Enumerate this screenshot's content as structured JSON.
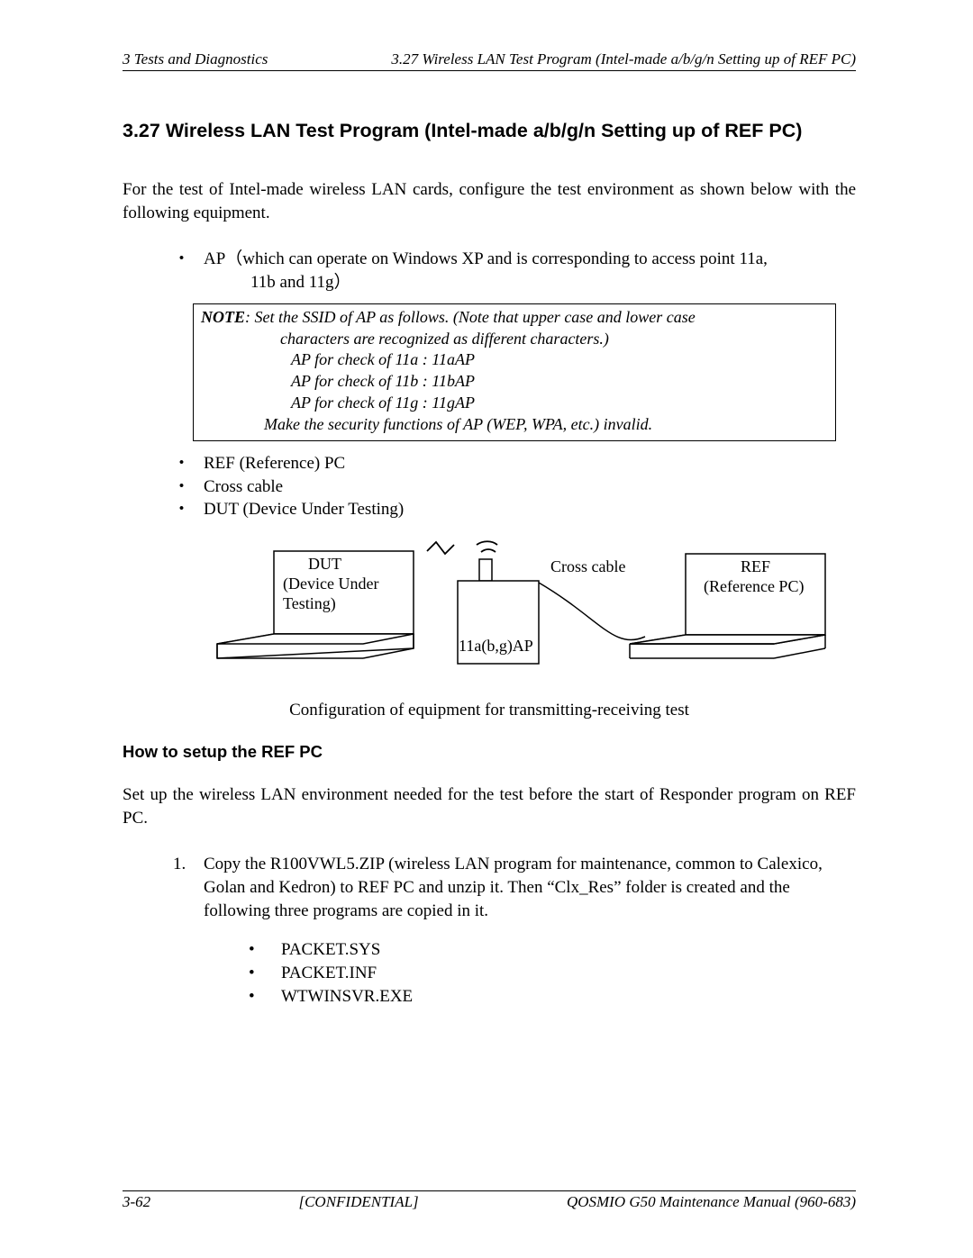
{
  "header": {
    "left": "3 Tests and Diagnostics",
    "right": "3.27 Wireless LAN Test Program (Intel-made a/b/g/n Setting up of REF PC)"
  },
  "section_heading": "3.27  Wireless LAN Test Program (Intel-made a/b/g/n Setting up of REF PC)",
  "intro_para": "For the test of Intel-made wireless LAN cards, configure the test environment as shown below with the following equipment.",
  "bullets": {
    "ap_main": "AP（which can operate on Windows XP and is corresponding to access point 11a,",
    "ap_sub": "11b and 11g）",
    "ref_pc": "REF (Reference) PC",
    "cross_cable": "Cross cable",
    "dut": "DUT (Device Under Testing)"
  },
  "note": {
    "label": "NOTE",
    "line1_rest": ":  Set the SSID of AP as follows. (Note that upper case and lower case",
    "line2": "characters are recognized as different characters.)",
    "line3": "AP for check of 11a : 11aAP",
    "line4": "AP for check of 11b : 11bAP",
    "line5": "AP for check of 11g : 11gAP",
    "line6": "Make the security functions of AP (WEP, WPA, etc.) invalid."
  },
  "diagram": {
    "dut_label1": "DUT",
    "dut_label2": "(Device Under",
    "dut_label3": "Testing)",
    "cross_cable": "Cross cable",
    "ap_label": "11a(b,g)AP",
    "ref_label1": "REF",
    "ref_label2": "(Reference PC)",
    "caption": "Configuration of equipment for transmitting-receiving test"
  },
  "sub_heading": "How to setup the REF PC",
  "setup_para": "Set up the wireless LAN environment needed for the test before the start of Responder program on REF PC.",
  "step1": "Copy the R100VWL5.ZIP (wireless LAN program for maintenance, common to Calexico, Golan and Kedron) to REF PC and unzip it. Then “Clx_Res” folder is created and the following three programs are copied in it.",
  "step1_marker": "1.",
  "programs": {
    "p1": "PACKET.SYS",
    "p2": "PACKET.INF",
    "p3": "WTWINSVR.EXE"
  },
  "footer": {
    "left": "3-62",
    "center": "[CONFIDENTIAL]",
    "right": "QOSMIO G50 Maintenance Manual (960-683)"
  }
}
